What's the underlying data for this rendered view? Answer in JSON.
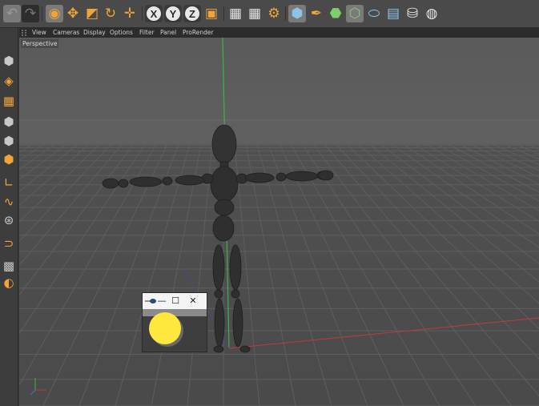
{
  "toolbar": {
    "undo_icon": "undo-icon",
    "redo_icon": "redo-icon",
    "axis_x": "X",
    "axis_y": "Y",
    "axis_z": "Z"
  },
  "viewport_menu": {
    "items": [
      "View",
      "Cameras",
      "Display",
      "Options",
      "Filter",
      "Panel",
      "ProRender"
    ]
  },
  "viewport": {
    "label": "Perspective"
  },
  "float_window": {
    "minimize": "—",
    "maximize": "☐",
    "close": "✕"
  },
  "colors": {
    "accent_orange": "#f0a43a",
    "yellow_dot": "#ffe83d",
    "axis_green": "#3fb24a",
    "axis_red": "#c23a3a"
  }
}
